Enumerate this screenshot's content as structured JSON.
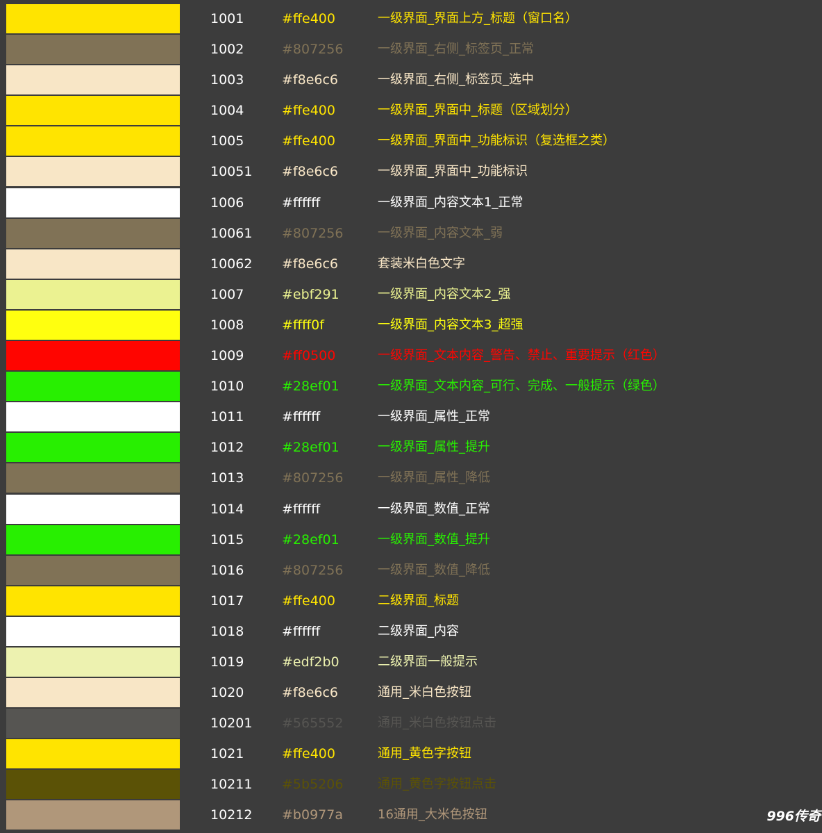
{
  "rows": [
    {
      "code": "1001",
      "hex": "#ffe400",
      "color": "#ffe400",
      "desc": "一级界面_界面上方_标题（窗口名）"
    },
    {
      "code": "1002",
      "hex": "#807256",
      "color": "#807256",
      "desc": "一级界面_右侧_标签页_正常"
    },
    {
      "code": "1003",
      "hex": "#f8e6c6",
      "color": "#f8e6c6",
      "desc": "一级界面_右侧_标签页_选中"
    },
    {
      "code": "1004",
      "hex": "#ffe400",
      "color": "#ffe400",
      "desc": "一级界面_界面中_标题（区域划分）"
    },
    {
      "code": "1005",
      "hex": "#ffe400",
      "color": "#ffe400",
      "desc": "一级界面_界面中_功能标识（复选框之类）"
    },
    {
      "code": "10051",
      "hex": "#f8e6c6",
      "color": "#f8e6c6",
      "desc": "一级界面_界面中_功能标识"
    },
    {
      "code": "1006",
      "hex": "#ffffff",
      "color": "#ffffff",
      "desc": "一级界面_内容文本1_正常"
    },
    {
      "code": "10061",
      "hex": "#807256",
      "color": "#807256",
      "desc": "一级界面_内容文本_弱"
    },
    {
      "code": "10062",
      "hex": "#f8e6c6",
      "color": "#f8e6c6",
      "desc": "套装米白色文字"
    },
    {
      "code": "1007",
      "hex": "#ebf291",
      "color": "#ebf291",
      "desc": "一级界面_内容文本2_强"
    },
    {
      "code": "1008",
      "hex": "#ffff0f",
      "color": "#ffff0f",
      "desc": "一级界面_内容文本3_超强"
    },
    {
      "code": "1009",
      "hex": "#ff0500",
      "color": "#ff0500",
      "desc": "一级界面_文本内容_警告、禁止、重要提示（红色）"
    },
    {
      "code": "1010",
      "hex": "#28ef01",
      "color": "#28ef01",
      "desc": "一级界面_文本内容_可行、完成、一般提示（绿色）"
    },
    {
      "code": "1011",
      "hex": "#ffffff",
      "color": "#ffffff",
      "desc": "一级界面_属性_正常"
    },
    {
      "code": "1012",
      "hex": "#28ef01",
      "color": "#28ef01",
      "desc": "一级界面_属性_提升"
    },
    {
      "code": "1013",
      "hex": "#807256",
      "color": "#807256",
      "desc": "一级界面_属性_降低"
    },
    {
      "code": "1014",
      "hex": "#ffffff",
      "color": "#ffffff",
      "desc": "一级界面_数值_正常"
    },
    {
      "code": "1015",
      "hex": "#28ef01",
      "color": "#28ef01",
      "desc": "一级界面_数值_提升"
    },
    {
      "code": "1016",
      "hex": "#807256",
      "color": "#807256",
      "desc": "一级界面_数值_降低"
    },
    {
      "code": "1017",
      "hex": "#ffe400",
      "color": "#ffe400",
      "desc": "二级界面_标题"
    },
    {
      "code": "1018",
      "hex": "#ffffff",
      "color": "#ffffff",
      "desc": "二级界面_内容"
    },
    {
      "code": "1019",
      "hex": "#edf2b0",
      "color": "#edf2b0",
      "desc": "二级界面一般提示"
    },
    {
      "code": "1020",
      "hex": "#f8e6c6",
      "color": "#f8e6c6",
      "desc": "通用_米白色按钮"
    },
    {
      "code": "10201",
      "hex": "#565552",
      "color": "#565552",
      "desc": "通用_米白色按钮点击"
    },
    {
      "code": "1021",
      "hex": "#ffe400",
      "color": "#ffe400",
      "desc": "通用_黄色字按钮"
    },
    {
      "code": "10211",
      "hex": "#5b5206",
      "color": "#5b5206",
      "desc": "通用_黄色字按钮点击"
    },
    {
      "code": "10212",
      "hex": "#b0977a",
      "color": "#b0977a",
      "desc": "16通用_大米色按钮"
    }
  ],
  "watermark": "996传奇"
}
